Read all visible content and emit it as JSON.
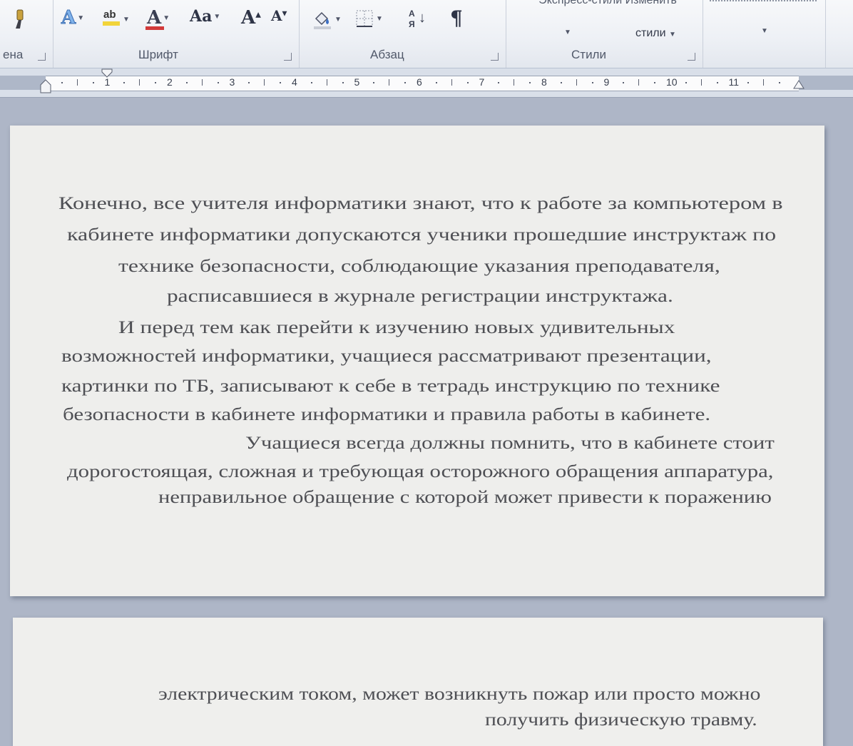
{
  "ribbon": {
    "clipboard_label_partial": "ена",
    "font_group_label": "Шрифт",
    "paragraph_group_label": "Абзац",
    "styles_group_label": "Стили",
    "styles_top_text": "Экспресс-стили  Изменить",
    "change_styles_label": "стили",
    "font_tools": [
      "text-effects-icon",
      "highlight-icon",
      "font-color-icon",
      "change-case-icon",
      "grow-font-icon",
      "shrink-font-icon"
    ],
    "paragraph_tools": [
      "shading-icon",
      "borders-icon",
      "sort-icon",
      "pilcrow-icon"
    ],
    "accent_font_color": "#d23a3a",
    "accent_highlight": "#f2d43a"
  },
  "ruler": {
    "numbers": [
      "1",
      "2",
      "3",
      "4",
      "5",
      "6",
      "7",
      "8",
      "9",
      "10",
      "11"
    ]
  },
  "document": {
    "page1_lines": [
      "Конечно, все учителя информатики знают, что к работе за компьютером в",
      "кабинете информатики допускаются ученики прошедшие инструктаж по",
      "технике безопасности, соблюдающие указания преподавателя,",
      "расписавшиеся в журнале регистрации инструктажа.",
      "И перед тем как перейти к изучению новых удивительных",
      "возможностей информатики, учащиеся рассматривают презентации,",
      "картинки по ТБ, записывают к себе в тетрадь инструкцию по технике",
      "безопасности в кабинете информатики и правила работы в кабинете.",
      "Учащиеся всегда должны помнить, что в кабинете стоит",
      "дорогостоящая, сложная и требующая осторожного обращения аппаратура,",
      "неправильное обращение с которой может привести к поражению"
    ],
    "page2_lines": [
      "электрическим током, может возникнуть пожар или просто можно",
      "получить физическую травму."
    ]
  }
}
